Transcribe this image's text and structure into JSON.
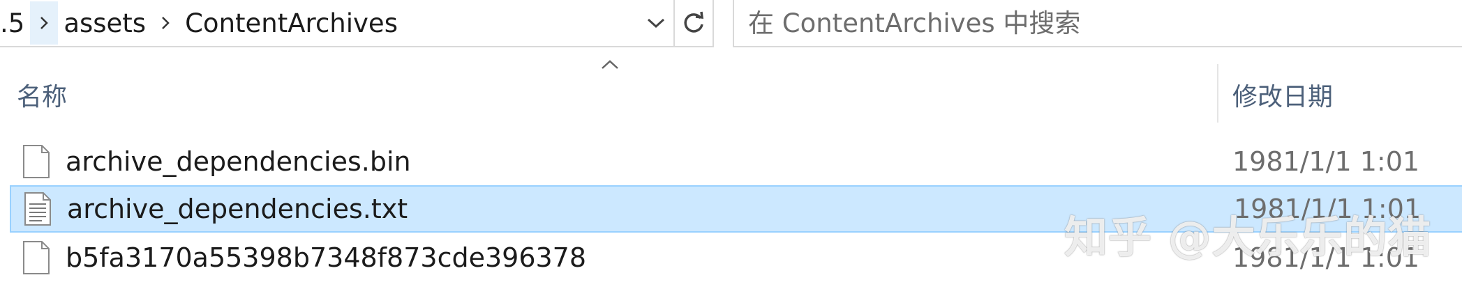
{
  "address_bar": {
    "crumbs": [
      ".5",
      "assets",
      "ContentArchives"
    ]
  },
  "search": {
    "placeholder": "在 ContentArchives 中搜索"
  },
  "columns": {
    "name": "名称",
    "date_modified": "修改日期"
  },
  "files": [
    {
      "name": "archive_dependencies.bin",
      "date": "1981/1/1 1:01",
      "selected": false
    },
    {
      "name": "archive_dependencies.txt",
      "date": "1981/1/1 1:01",
      "selected": true
    },
    {
      "name": "b5fa3170a55398b7348f873cde396378",
      "date": "1981/1/1 1:01",
      "selected": false
    }
  ],
  "watermark": "知乎 @大乐乐的猫",
  "colors": {
    "selection_fill": "#cce8ff",
    "selection_border": "#99d1ff",
    "header_text": "#4c607a",
    "date_text": "#6d6d6d"
  }
}
